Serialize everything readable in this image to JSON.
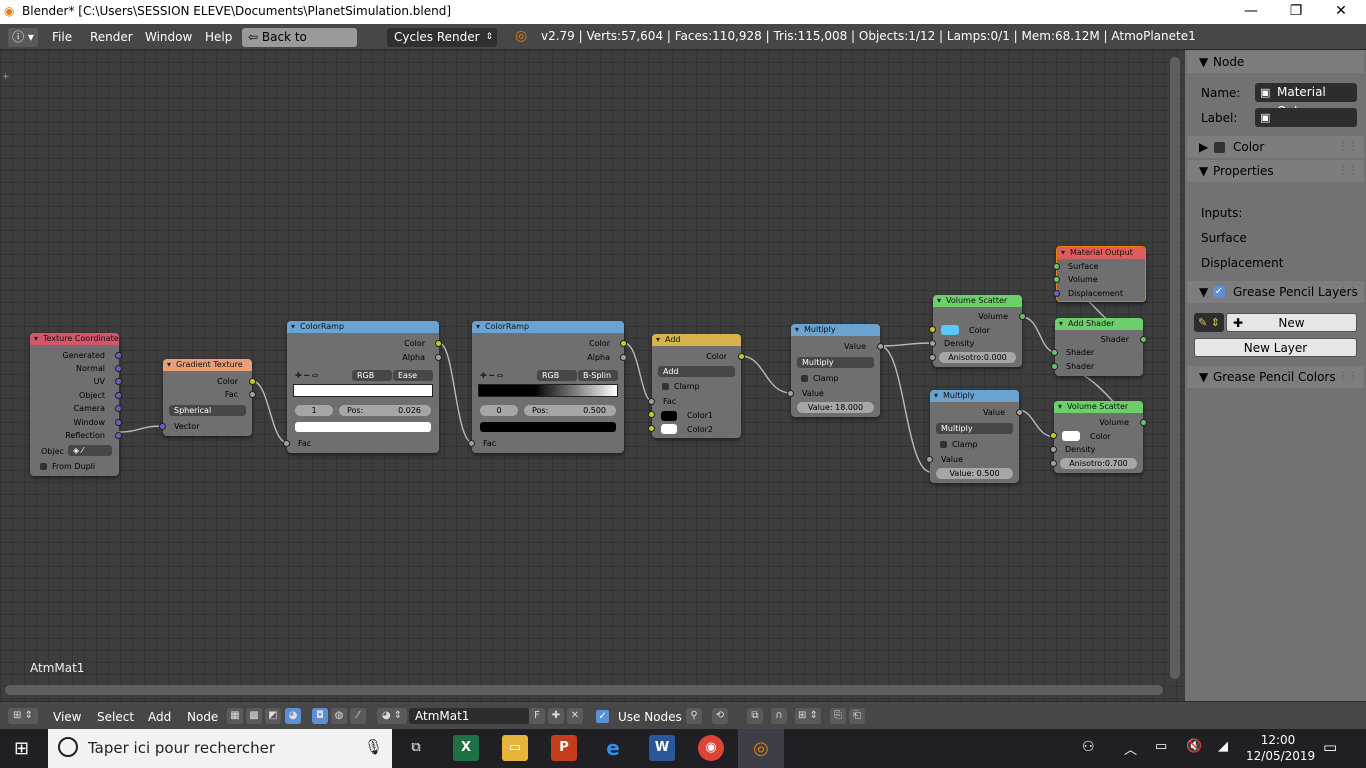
{
  "window": {
    "title": "Blender* [C:\\Users\\SESSION ELEVE\\Documents\\PlanetSimulation.blend]",
    "minimize": "—",
    "restore": "❐",
    "close": "✕"
  },
  "infobar": {
    "menus": [
      "File",
      "Render",
      "Window",
      "Help"
    ],
    "back_button": "Back to Previous",
    "engine": "Cycles Render",
    "stats": "v2.79 | Verts:57,604 | Faces:110,928 | Tris:115,008 | Objects:1/12 | Lamps:0/1 | Mem:68.12M | AtmoPlanete1"
  },
  "editor": {
    "material_label": "AtmMat1",
    "nodes": {
      "texcoord": {
        "title": "Texture Coordinate",
        "outputs": [
          "Generated",
          "Normal",
          "UV",
          "Object",
          "Camera",
          "Window",
          "Reflection"
        ],
        "object_label": "Objec",
        "from_dupli": "From Dupli"
      },
      "gradient": {
        "title": "Gradient Texture",
        "outputs": [
          "Color",
          "Fac"
        ],
        "mode": "Spherical",
        "input": "Vector"
      },
      "ramp1": {
        "title": "ColorRamp",
        "outputs": [
          "Color",
          "Alpha"
        ],
        "color_mode": "RGB",
        "interp": "Ease",
        "index": "1",
        "pos": "Pos:",
        "pos_value": "0.026",
        "input": "Fac"
      },
      "ramp2": {
        "title": "ColorRamp",
        "outputs": [
          "Color",
          "Alpha"
        ],
        "color_mode": "RGB",
        "interp": "B-Splin",
        "index": "0",
        "pos": "Pos:",
        "pos_value": "0.500",
        "input": "Fac"
      },
      "add": {
        "title": "Add",
        "output": "Color",
        "mode": "Add",
        "clamp": "Clamp",
        "inputs": [
          "Fac",
          "Color1",
          "Color2"
        ]
      },
      "multiply1": {
        "title": "Multiply",
        "output": "Value",
        "mode": "Multiply",
        "clamp": "Clamp",
        "input": "Value",
        "value_field": "Value:  18.000"
      },
      "multiply2": {
        "title": "Multiply",
        "output": "Value",
        "mode": "Multiply",
        "clamp": "Clamp",
        "input": "Value",
        "value_field": "Value:  0.500"
      },
      "scatter1": {
        "title": "Volume Scatter",
        "output": "Volume",
        "inputs": [
          "Color",
          "Density"
        ],
        "anisotropy": "Anisotro:0.000"
      },
      "scatter2": {
        "title": "Volume Scatter",
        "output": "Volume",
        "inputs": [
          "Color",
          "Density"
        ],
        "anisotropy": "Anisotro:0.700"
      },
      "addshader": {
        "title": "Add Shader",
        "output": "Shader",
        "inputs": [
          "Shader",
          "Shader"
        ]
      },
      "matout": {
        "title": "Material Output",
        "inputs": [
          "Surface",
          "Volume",
          "Displacement"
        ]
      }
    }
  },
  "panel": {
    "node_section": "Node",
    "name_label": "Name:",
    "name_value": "Material Outp...",
    "label_label": "Label:",
    "color_section": "Color",
    "properties_section": "Properties",
    "inputs_label": "Inputs:",
    "surface_label": "Surface",
    "displacement_label": "Displacement",
    "gp_layers_section": "Grease Pencil Layers",
    "new_button": "New",
    "new_layer_button": "New Layer",
    "gp_colors_section": "Grease Pencil Colors"
  },
  "header": {
    "menus": [
      "View",
      "Select",
      "Add",
      "Node"
    ],
    "material": "AtmMat1",
    "fake_user": "F",
    "use_nodes": "Use Nodes"
  },
  "taskbar": {
    "search_placeholder": "Taper ici pour rechercher",
    "time": "12:00",
    "date": "12/05/2019"
  },
  "colors": {
    "texcoord_header": "#d2576b",
    "texture_header": "#e7a07a",
    "converter_header": "#6aa3cf",
    "color_header": "#d6b34b",
    "shader_header": "#6ccf6c",
    "output_header": "#e05b5b",
    "scatter1_color": "#5ac8fa",
    "scatter2_color": "#ffffff"
  }
}
